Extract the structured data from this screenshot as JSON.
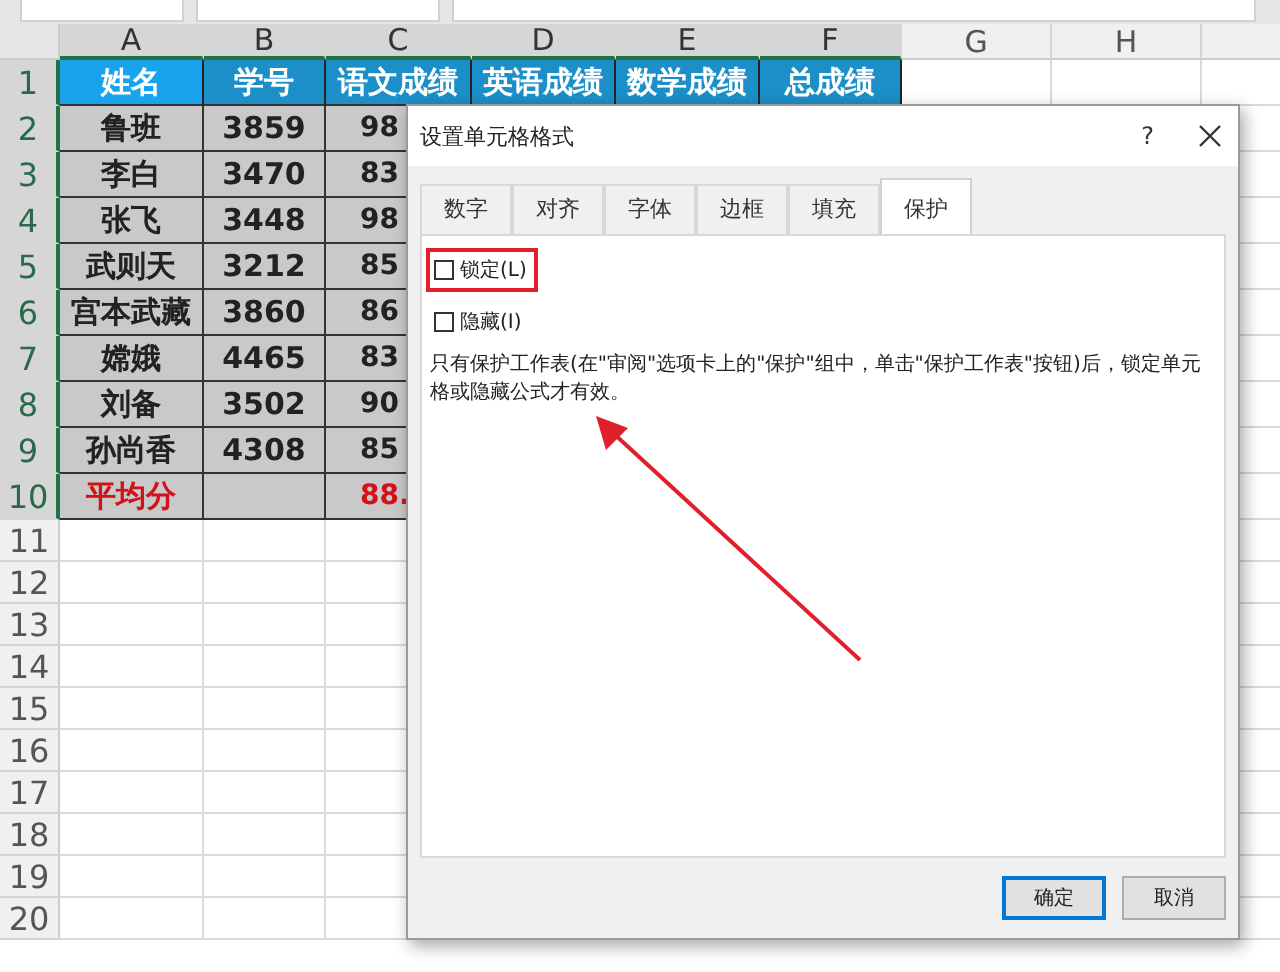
{
  "sheet": {
    "columns": [
      {
        "label": "A",
        "selected": true
      },
      {
        "label": "B",
        "selected": true
      },
      {
        "label": "C",
        "selected": true
      },
      {
        "label": "D",
        "selected": true
      },
      {
        "label": "E",
        "selected": true
      },
      {
        "label": "F",
        "selected": true
      },
      {
        "label": "G",
        "selected": false
      },
      {
        "label": "H",
        "selected": false
      }
    ],
    "rows": [
      {
        "number": "1",
        "selected": true,
        "kind": "header",
        "cells": [
          "姓名",
          "学号",
          "语文成绩",
          "英语成绩",
          "数学成绩",
          "总成绩"
        ]
      },
      {
        "number": "2",
        "selected": true,
        "kind": "data",
        "cells": [
          "鲁班",
          "3859",
          "98"
        ]
      },
      {
        "number": "3",
        "selected": true,
        "kind": "data",
        "cells": [
          "李白",
          "3470",
          "83"
        ]
      },
      {
        "number": "4",
        "selected": true,
        "kind": "data",
        "cells": [
          "张飞",
          "3448",
          "98"
        ]
      },
      {
        "number": "5",
        "selected": true,
        "kind": "data",
        "cells": [
          "武则天",
          "3212",
          "85"
        ]
      },
      {
        "number": "6",
        "selected": true,
        "kind": "data",
        "cells": [
          "宫本武藏",
          "3860",
          "86"
        ]
      },
      {
        "number": "7",
        "selected": true,
        "kind": "data",
        "cells": [
          "嫦娥",
          "4465",
          "83"
        ]
      },
      {
        "number": "8",
        "selected": true,
        "kind": "data",
        "cells": [
          "刘备",
          "3502",
          "90"
        ]
      },
      {
        "number": "9",
        "selected": true,
        "kind": "data",
        "cells": [
          "孙尚香",
          "4308",
          "85"
        ]
      },
      {
        "number": "10",
        "selected": true,
        "kind": "summary",
        "cells": [
          "平均分",
          "",
          "88."
        ]
      },
      {
        "number": "11",
        "selected": false,
        "kind": "empty",
        "cells": []
      },
      {
        "number": "12",
        "selected": false,
        "kind": "empty",
        "cells": []
      },
      {
        "number": "13",
        "selected": false,
        "kind": "empty",
        "cells": []
      },
      {
        "number": "14",
        "selected": false,
        "kind": "empty",
        "cells": []
      },
      {
        "number": "15",
        "selected": false,
        "kind": "empty",
        "cells": []
      },
      {
        "number": "16",
        "selected": false,
        "kind": "empty",
        "cells": []
      },
      {
        "number": "17",
        "selected": false,
        "kind": "empty",
        "cells": []
      },
      {
        "number": "18",
        "selected": false,
        "kind": "empty",
        "cells": []
      },
      {
        "number": "19",
        "selected": false,
        "kind": "empty",
        "cells": []
      },
      {
        "number": "20",
        "selected": false,
        "kind": "empty",
        "cells": []
      }
    ]
  },
  "dialog": {
    "title": "设置单元格格式",
    "help": "?",
    "tabs": [
      {
        "label": "数字",
        "selected": false
      },
      {
        "label": "对齐",
        "selected": false
      },
      {
        "label": "字体",
        "selected": false
      },
      {
        "label": "边框",
        "selected": false
      },
      {
        "label": "填充",
        "selected": false
      },
      {
        "label": "保护",
        "selected": true
      }
    ],
    "checkboxes": [
      {
        "label": "锁定(L)",
        "checked": false,
        "highlighted": true
      },
      {
        "label": "隐藏(I)",
        "checked": false,
        "highlighted": false
      }
    ],
    "description": "只有保护工作表(在\"审阅\"选项卡上的\"保护\"组中，单击\"保护工作表\"按钮)后，锁定单元格或隐藏公式才有效。",
    "buttons": [
      {
        "label": "确定",
        "focused": true
      },
      {
        "label": "取消",
        "focused": false
      }
    ]
  }
}
